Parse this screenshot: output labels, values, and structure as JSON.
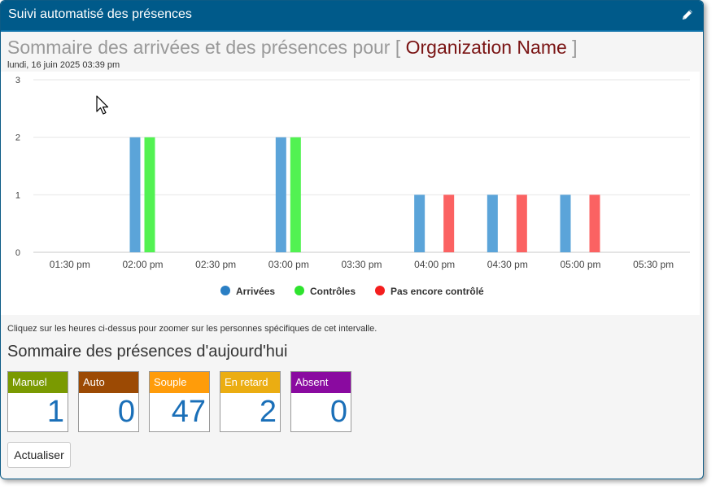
{
  "window": {
    "title": "Suivi automatisé des présences"
  },
  "heading": {
    "prefix": "Sommaire des arrivées et des présences pour [ ",
    "org": "Organization Name",
    "suffix": " ]"
  },
  "datestamp": "lundi, 16 juin 2025 03:39 pm",
  "chart_data": {
    "type": "bar",
    "categories": [
      "01:30 pm",
      "02:00 pm",
      "02:30 pm",
      "03:00 pm",
      "03:30 pm",
      "04:00 pm",
      "04:30 pm",
      "05:00 pm",
      "05:30 pm"
    ],
    "series": [
      {
        "name": "Arrivées",
        "color": "#5ba4d9",
        "legend_color": "#2a7fc4",
        "values": [
          0,
          2,
          0,
          2,
          0,
          1,
          1,
          1,
          0
        ]
      },
      {
        "name": "Contrôles",
        "color": "#52f252",
        "legend_color": "#2ee32e",
        "values": [
          0,
          2,
          0,
          2,
          0,
          0,
          0,
          0,
          0
        ]
      },
      {
        "name": "Pas encore contrôlé",
        "color": "#fb6262",
        "legend_color": "#f41e1e",
        "values": [
          0,
          0,
          0,
          0,
          0,
          1,
          1,
          1,
          0
        ]
      }
    ],
    "ylim": [
      0,
      3
    ],
    "yticks": [
      "0",
      "1",
      "2",
      "3"
    ],
    "grid": true,
    "legend": "bottom-center"
  },
  "hint": "Cliquez sur les heures ci-dessus pour zoomer sur les personnes spécifiques de cet intervalle.",
  "summary": {
    "title": "Sommaire des présences d'aujourd'hui",
    "tiles": [
      {
        "label": "Manuel",
        "value": "1",
        "color": "#7a9a01"
      },
      {
        "label": "Auto",
        "value": "0",
        "color": "#9c4a04"
      },
      {
        "label": "Souple",
        "value": "47",
        "color": "#ff9c0a"
      },
      {
        "label": "En retard",
        "value": "2",
        "color": "#ebad12"
      },
      {
        "label": "Absent",
        "value": "0",
        "color": "#8a0aa0"
      }
    ]
  },
  "refresh_label": "Actualiser",
  "icons": {
    "edit": "pencil-icon",
    "cursor": "mouse-pointer-icon"
  }
}
